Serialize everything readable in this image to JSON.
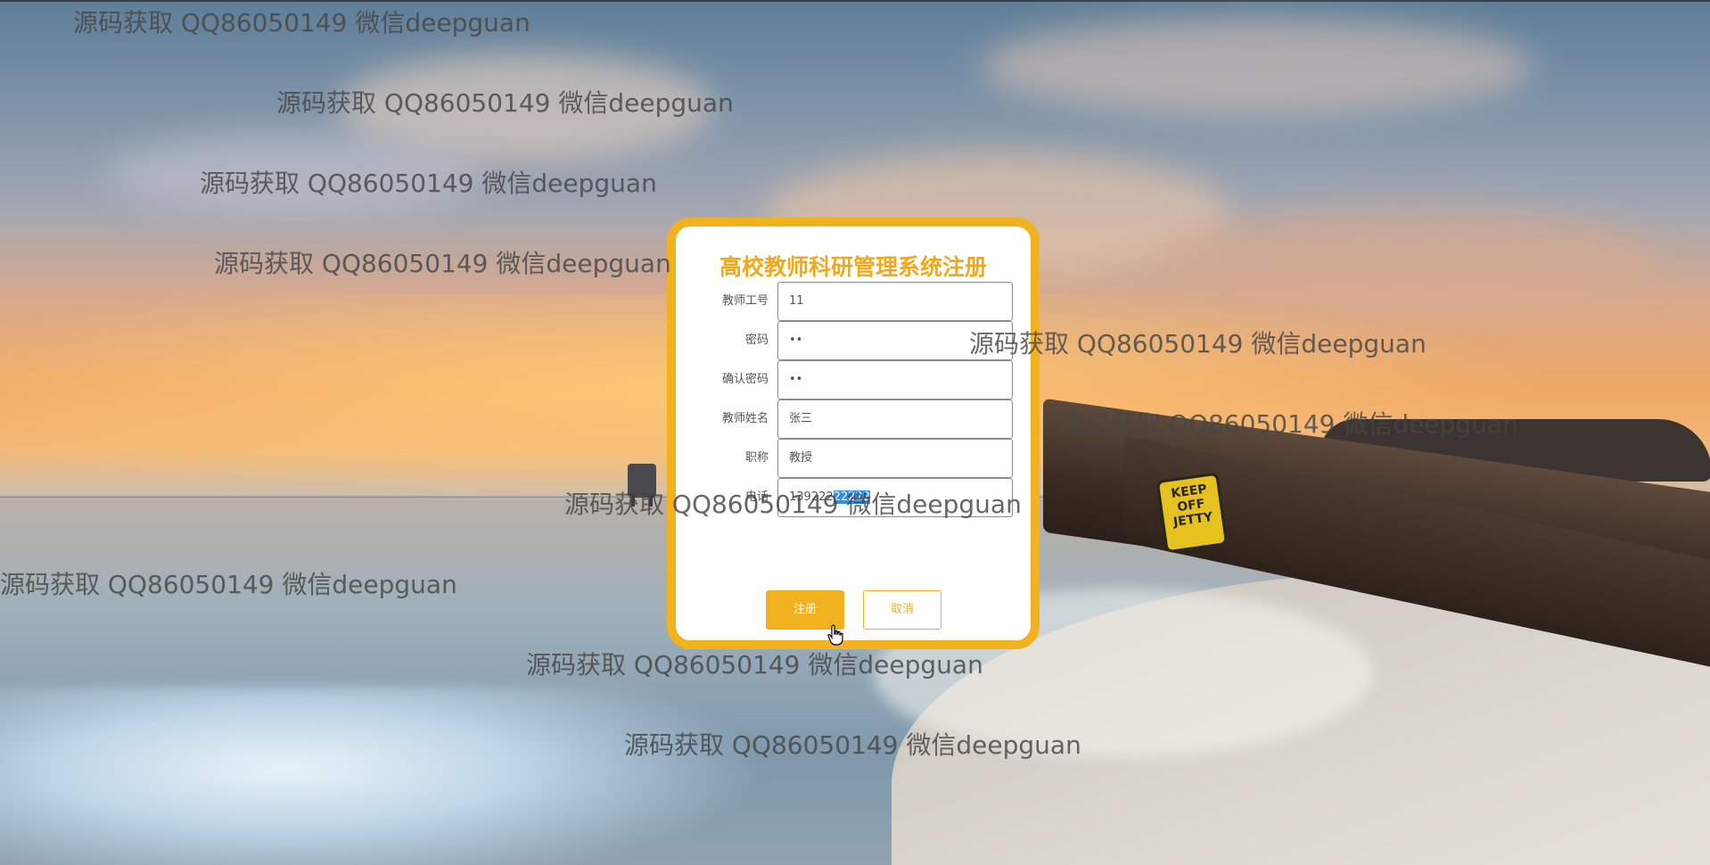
{
  "form": {
    "title": "高校教师科研管理系统注册",
    "fields": [
      {
        "label": "教师工号",
        "value": "11"
      },
      {
        "label": "密码",
        "value": "••"
      },
      {
        "label": "确认密码",
        "value": "••"
      },
      {
        "label": "教师姓名",
        "value": "张三"
      },
      {
        "label": "职称",
        "value": "教授"
      },
      {
        "label": "电话",
        "value_prefix": "139222",
        "value_selected": "22222"
      }
    ],
    "register_label": "注册",
    "cancel_label": "取消",
    "accent_color": "#f2b21f"
  },
  "background": {
    "sign_text": "KEEP OFF JETTY"
  },
  "watermarks": [
    "源码获取 QQ86050149 微信deepguan",
    "源码获取 QQ86050149 微信deepguan",
    "源码获取 QQ86050149 微信deepguan",
    "源码获取 QQ86050149 微信deepguan",
    "源码获取 QQ86050149 微信deepguan",
    "源码获取 QQ86050149 微信deepguan",
    "源码获取 QQ86050149 微信deepguan",
    "源码获取 QQ86050149 微信deepguan",
    "源码获取 QQ86050149 微信deepguan",
    "源码获取 QQ86050149 微信deepguan"
  ]
}
